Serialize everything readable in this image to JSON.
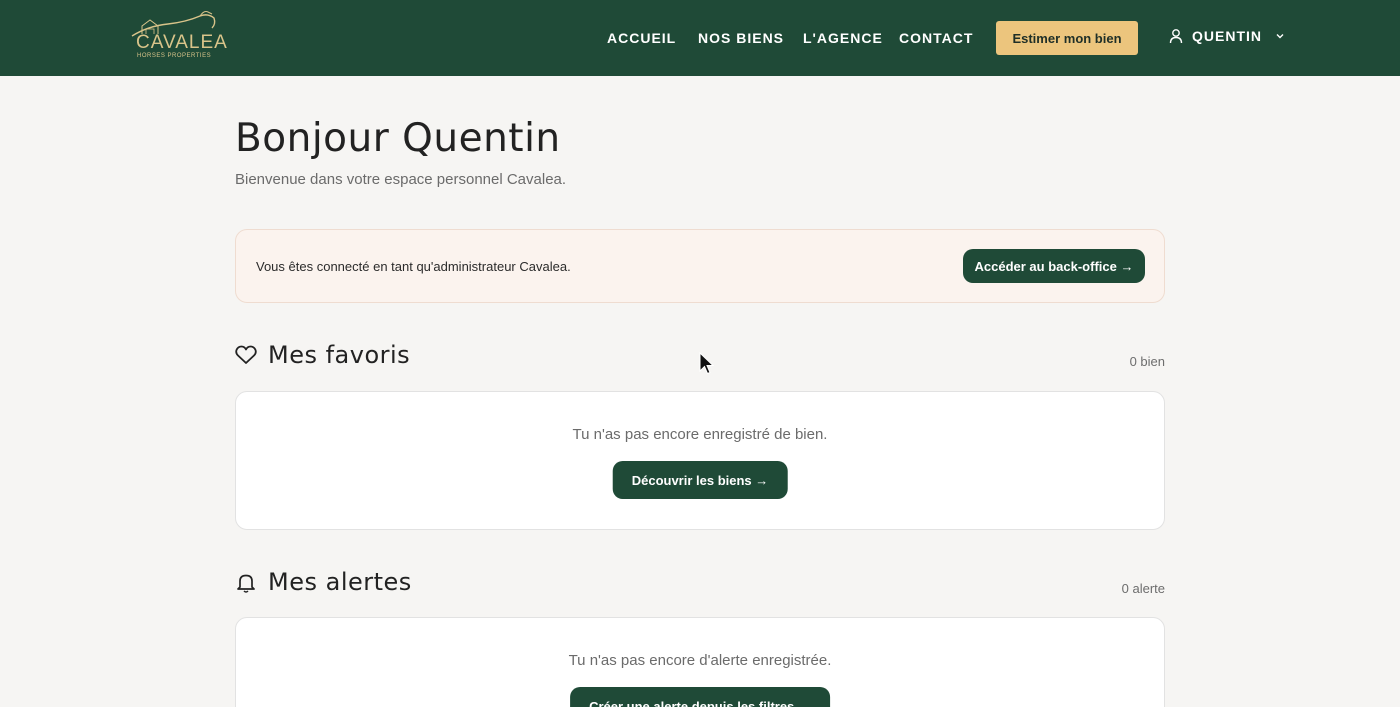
{
  "brand": {
    "name": "CAVALEA",
    "tagline": "HORSES PROPERTIES",
    "color_primary": "#1f4a37",
    "color_accent": "#ecc57d"
  },
  "nav": {
    "items": [
      "ACCUEIL",
      "NOS BIENS",
      "L'AGENCE",
      "CONTACT"
    ],
    "cta_label": "Estimer mon bien",
    "user_label": "QUENTIN",
    "user_icon": "user-icon",
    "user_dropdown_icon": "chevron-down-icon"
  },
  "page": {
    "title": "Bonjour Quentin",
    "subtitle": "Bienvenue dans votre espace personnel Cavalea."
  },
  "admin_notice": {
    "text": "Vous êtes connecté en tant qu'administrateur Cavalea.",
    "button_label": "Accéder au back-office →"
  },
  "favorites": {
    "title": "Mes favoris",
    "icon": "heart-icon",
    "count": "0 bien",
    "empty_message": "Tu n'as pas encore enregistré de bien.",
    "button_label": "Découvrir les biens →"
  },
  "alerts": {
    "title": "Mes alertes",
    "icon": "bell-icon",
    "count": "0 alerte",
    "empty_message": "Tu n'as pas encore d'alerte enregistrée.",
    "button_label": "Créer une alerte depuis les filtres →"
  }
}
